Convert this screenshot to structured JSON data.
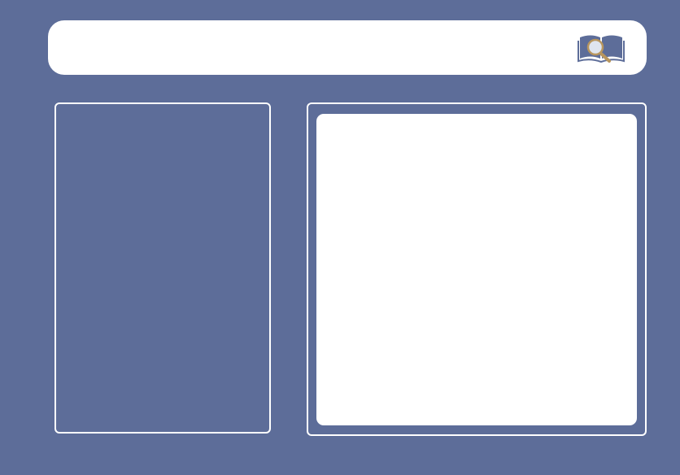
{
  "theme": {
    "background_color": "#5d6d99",
    "surface_color": "#ffffff",
    "icon_primary_color": "#5d6d99",
    "icon_accent_color": "#b8965e"
  },
  "header": {
    "icon": "book-search-icon"
  }
}
